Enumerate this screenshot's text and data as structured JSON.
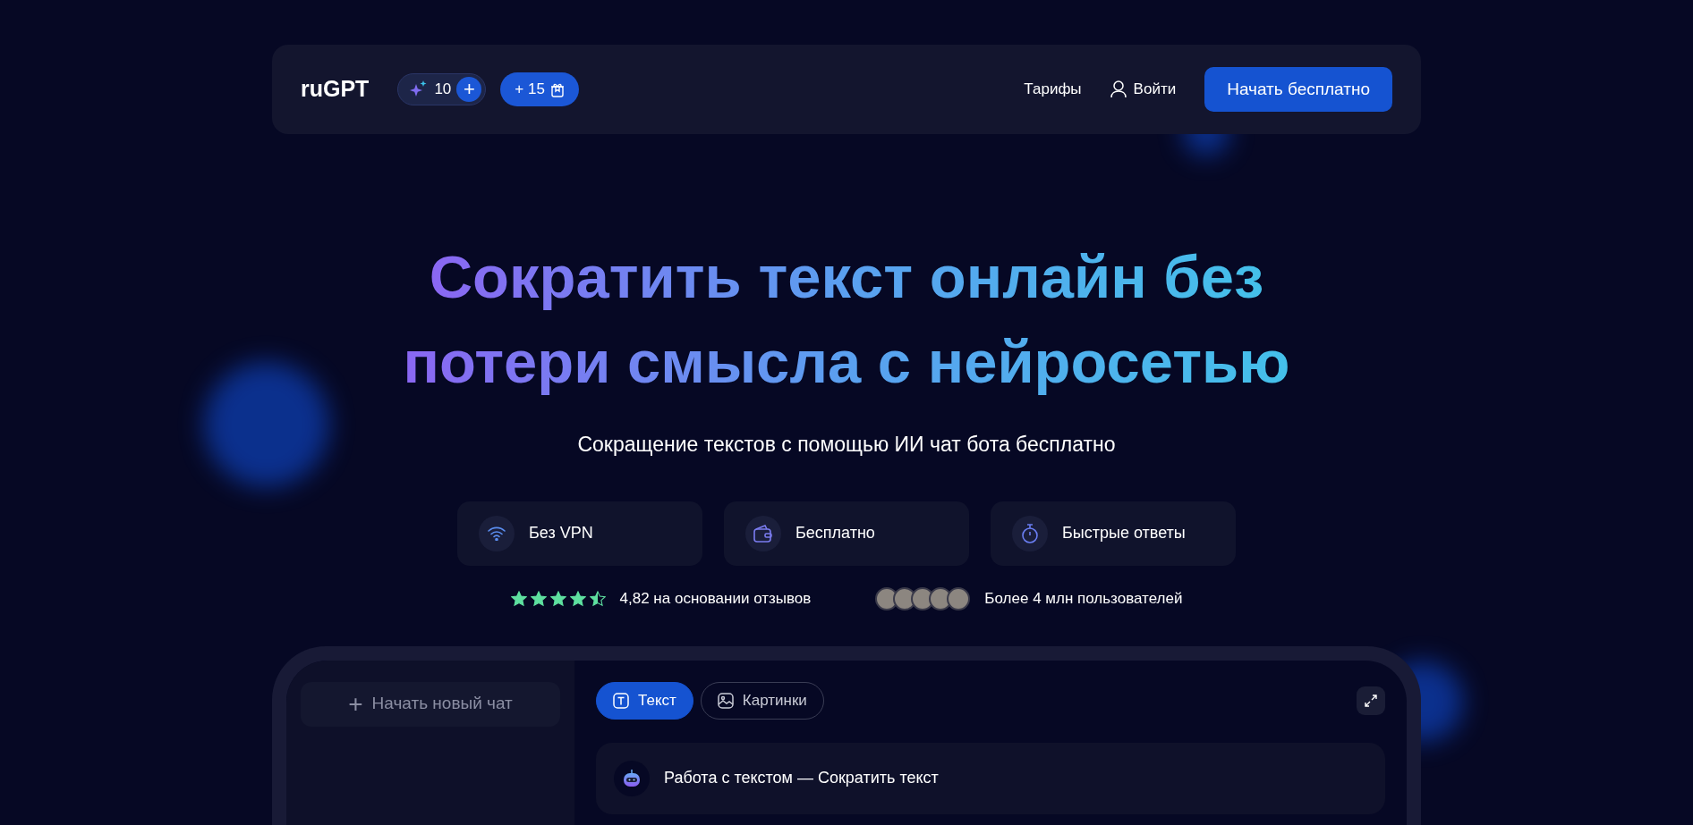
{
  "header": {
    "logo": "ruGPT",
    "credits": {
      "count": "10",
      "add": "+"
    },
    "bonus": {
      "label": "+ 15"
    },
    "nav": [
      {
        "label": "Тарифы",
        "kind": "link"
      },
      {
        "label": "Войти",
        "kind": "login"
      }
    ],
    "cta": "Начать бесплатно"
  },
  "hero": {
    "title_lines": [
      "Сократить текст онлайн без",
      "потери смысла с нейросетью"
    ],
    "subtitle": "Сокращение текстов с помощью ИИ чат бота бесплатно"
  },
  "features": [
    {
      "label": "Без VPN",
      "kind": "wifi"
    },
    {
      "label": "Бесплатно",
      "kind": "wallet"
    },
    {
      "label": "Быстрые ответы",
      "kind": "timer"
    }
  ],
  "rating": {
    "stars": 4.5,
    "text": "4,82 на основании отзывов"
  },
  "users": {
    "text": "Более 4 млн пользователей"
  },
  "chat": {
    "new_chat": "Начать новый чат",
    "new_chat_icon": "+",
    "tabs": [
      {
        "label": "Текст",
        "kind": "text",
        "selected": true
      },
      {
        "label": "Картинки",
        "kind": "image",
        "selected": false
      }
    ],
    "message": "Работа с текстом — Сократить текст"
  }
}
